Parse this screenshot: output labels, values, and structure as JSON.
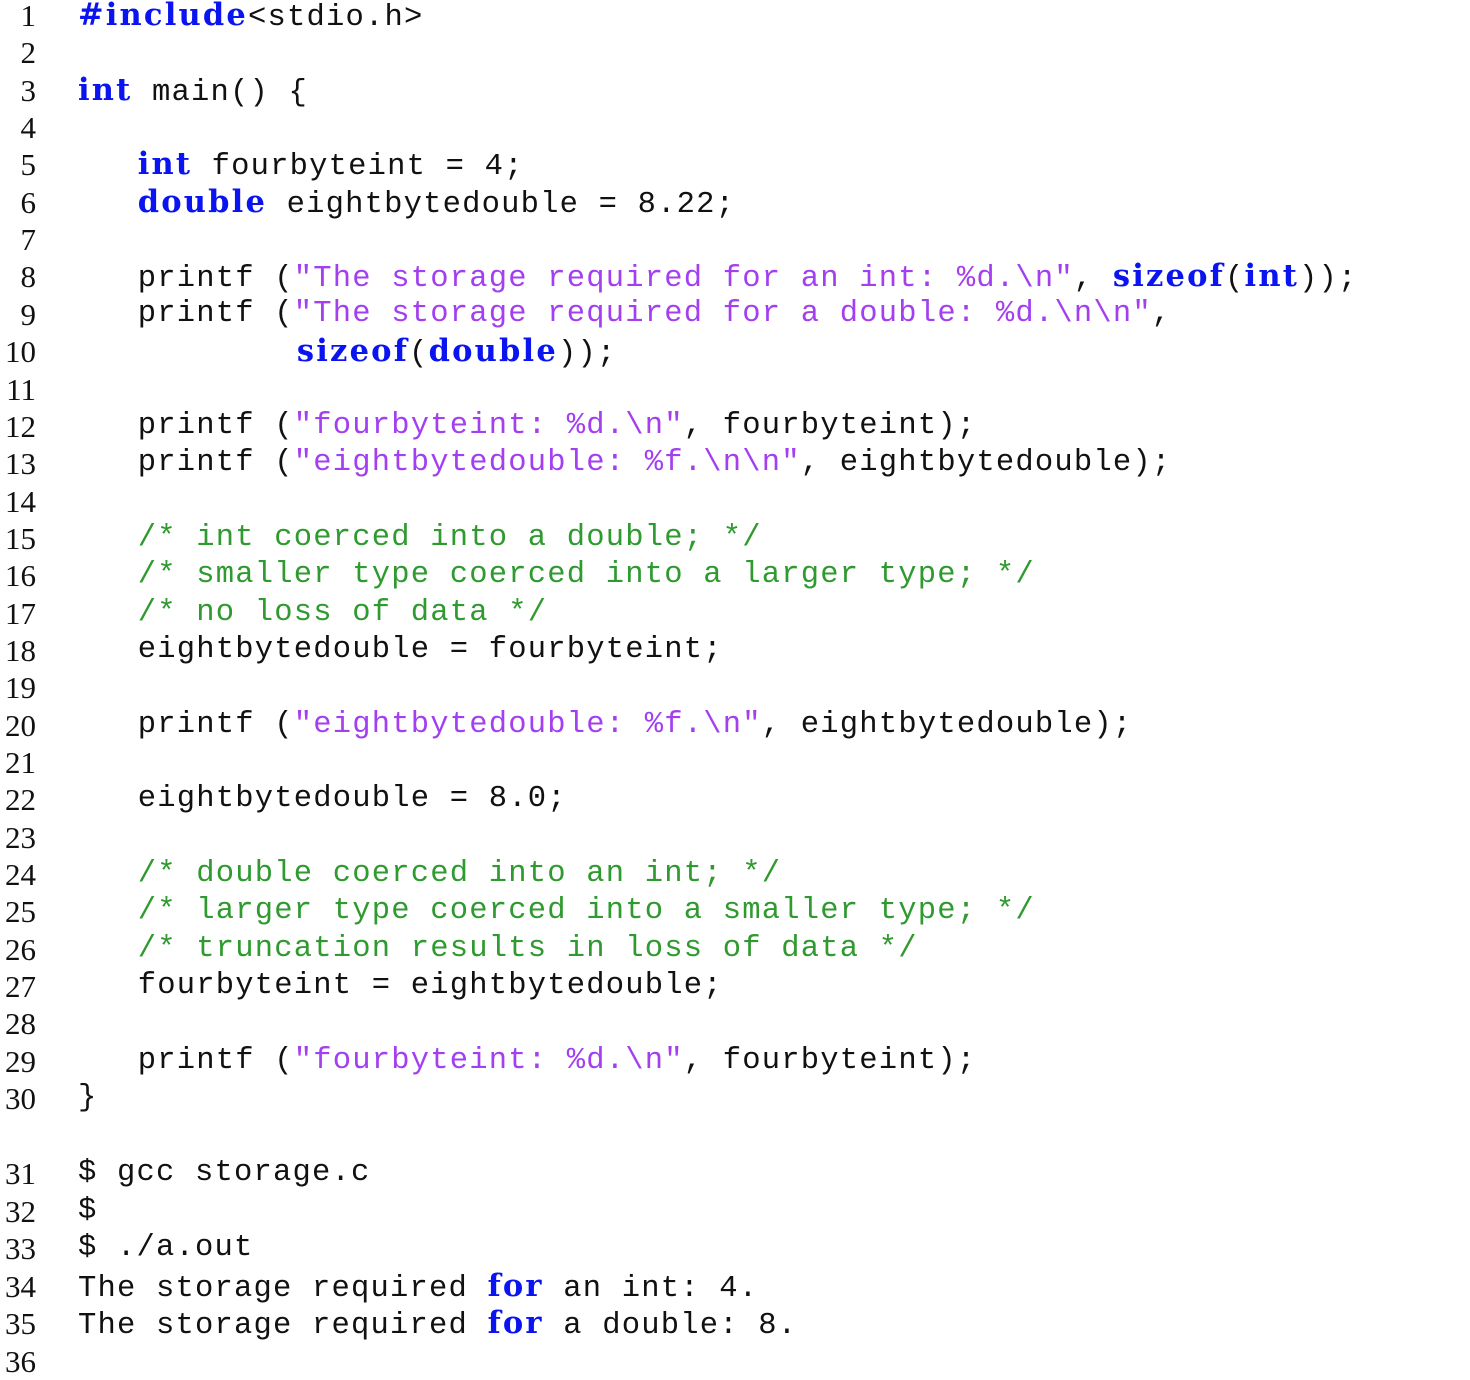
{
  "document": {
    "type": "code-listing",
    "language": "C",
    "colors": {
      "keyword": "#0a14f0",
      "string": "#a33ff0",
      "comment": "#2f9a2f",
      "plain": "#111111"
    },
    "lines": [
      {
        "n": "1",
        "indent": 0,
        "tokens": [
          {
            "t": "kw",
            "v": "#include"
          },
          {
            "t": "plain",
            "v": "<stdio.h>"
          }
        ]
      },
      {
        "n": "2",
        "indent": 0,
        "tokens": []
      },
      {
        "n": "3",
        "indent": 0,
        "tokens": [
          {
            "t": "kw",
            "v": "int"
          },
          {
            "t": "plain",
            "v": " main() {"
          }
        ]
      },
      {
        "n": "4",
        "indent": 0,
        "tokens": []
      },
      {
        "n": "5",
        "indent": 3,
        "tokens": [
          {
            "t": "kw",
            "v": "int"
          },
          {
            "t": "plain",
            "v": " fourbyteint = 4;"
          }
        ]
      },
      {
        "n": "6",
        "indent": 3,
        "tokens": [
          {
            "t": "kw",
            "v": "double"
          },
          {
            "t": "plain",
            "v": " eightbytedouble = 8.22;"
          }
        ]
      },
      {
        "n": "7",
        "indent": 0,
        "tokens": []
      },
      {
        "n": "8",
        "indent": 3,
        "tokens": [
          {
            "t": "plain",
            "v": "printf ("
          },
          {
            "t": "str",
            "v": "\"The storage required for an int: %d.\\n\""
          },
          {
            "t": "plain",
            "v": ", "
          },
          {
            "t": "kw",
            "v": "sizeof"
          },
          {
            "t": "plain",
            "v": "("
          },
          {
            "t": "kw",
            "v": "int"
          },
          {
            "t": "plain",
            "v": "));"
          }
        ]
      },
      {
        "n": "9",
        "indent": 3,
        "tokens": [
          {
            "t": "plain",
            "v": "printf ("
          },
          {
            "t": "str",
            "v": "\"The storage required for a double: %d.\\n\\n\""
          },
          {
            "t": "plain",
            "v": ","
          }
        ]
      },
      {
        "n": "10",
        "indent": 11,
        "tokens": [
          {
            "t": "kw",
            "v": "sizeof"
          },
          {
            "t": "plain",
            "v": "("
          },
          {
            "t": "kw",
            "v": "double"
          },
          {
            "t": "plain",
            "v": "));"
          }
        ]
      },
      {
        "n": "11",
        "indent": 0,
        "tokens": []
      },
      {
        "n": "12",
        "indent": 3,
        "tokens": [
          {
            "t": "plain",
            "v": "printf ("
          },
          {
            "t": "str",
            "v": "\"fourbyteint: %d.\\n\""
          },
          {
            "t": "plain",
            "v": ", fourbyteint);"
          }
        ]
      },
      {
        "n": "13",
        "indent": 3,
        "tokens": [
          {
            "t": "plain",
            "v": "printf ("
          },
          {
            "t": "str",
            "v": "\"eightbytedouble: %f.\\n\\n\""
          },
          {
            "t": "plain",
            "v": ", eightbytedouble);"
          }
        ]
      },
      {
        "n": "14",
        "indent": 0,
        "tokens": []
      },
      {
        "n": "15",
        "indent": 3,
        "tokens": [
          {
            "t": "cmt",
            "v": "/* int coerced into a double; */"
          }
        ]
      },
      {
        "n": "16",
        "indent": 3,
        "tokens": [
          {
            "t": "cmt",
            "v": "/* smaller type coerced into a larger type; */"
          }
        ]
      },
      {
        "n": "17",
        "indent": 3,
        "tokens": [
          {
            "t": "cmt",
            "v": "/* no loss of data */"
          }
        ]
      },
      {
        "n": "18",
        "indent": 3,
        "tokens": [
          {
            "t": "plain",
            "v": "eightbytedouble = fourbyteint;"
          }
        ]
      },
      {
        "n": "19",
        "indent": 0,
        "tokens": []
      },
      {
        "n": "20",
        "indent": 3,
        "tokens": [
          {
            "t": "plain",
            "v": "printf ("
          },
          {
            "t": "str",
            "v": "\"eightbytedouble: %f.\\n\""
          },
          {
            "t": "plain",
            "v": ", eightbytedouble);"
          }
        ]
      },
      {
        "n": "21",
        "indent": 0,
        "tokens": []
      },
      {
        "n": "22",
        "indent": 3,
        "tokens": [
          {
            "t": "plain",
            "v": "eightbytedouble = 8.0;"
          }
        ]
      },
      {
        "n": "23",
        "indent": 0,
        "tokens": []
      },
      {
        "n": "24",
        "indent": 3,
        "tokens": [
          {
            "t": "cmt",
            "v": "/* double coerced into an int; */"
          }
        ]
      },
      {
        "n": "25",
        "indent": 3,
        "tokens": [
          {
            "t": "cmt",
            "v": "/* larger type coerced into a smaller type; */"
          }
        ]
      },
      {
        "n": "26",
        "indent": 3,
        "tokens": [
          {
            "t": "cmt",
            "v": "/* truncation results in loss of data */"
          }
        ]
      },
      {
        "n": "27",
        "indent": 3,
        "tokens": [
          {
            "t": "plain",
            "v": "fourbyteint = eightbytedouble;"
          }
        ]
      },
      {
        "n": "28",
        "indent": 0,
        "tokens": []
      },
      {
        "n": "29",
        "indent": 3,
        "tokens": [
          {
            "t": "plain",
            "v": "printf ("
          },
          {
            "t": "str",
            "v": "\"fourbyteint: %d.\\n\""
          },
          {
            "t": "plain",
            "v": ", fourbyteint);"
          }
        ]
      },
      {
        "n": "30",
        "indent": 0,
        "tokens": [
          {
            "t": "plain",
            "v": "}"
          }
        ]
      },
      {
        "n": "31",
        "indent": 0,
        "tokens": [
          {
            "t": "plain",
            "v": "$ gcc storage.c"
          }
        ]
      },
      {
        "n": "32",
        "indent": 0,
        "tokens": [
          {
            "t": "plain",
            "v": "$"
          }
        ]
      },
      {
        "n": "33",
        "indent": 0,
        "tokens": [
          {
            "t": "plain",
            "v": "$ ./a.out"
          }
        ]
      },
      {
        "n": "34",
        "indent": 0,
        "tokens": [
          {
            "t": "plain",
            "v": "The storage required "
          },
          {
            "t": "kw",
            "v": "for"
          },
          {
            "t": "plain",
            "v": " an int: 4."
          }
        ]
      },
      {
        "n": "35",
        "indent": 0,
        "tokens": [
          {
            "t": "plain",
            "v": "The storage required "
          },
          {
            "t": "kw",
            "v": "for"
          },
          {
            "t": "plain",
            "v": " a double: 8."
          }
        ]
      },
      {
        "n": "36",
        "indent": 0,
        "tokens": []
      }
    ]
  }
}
